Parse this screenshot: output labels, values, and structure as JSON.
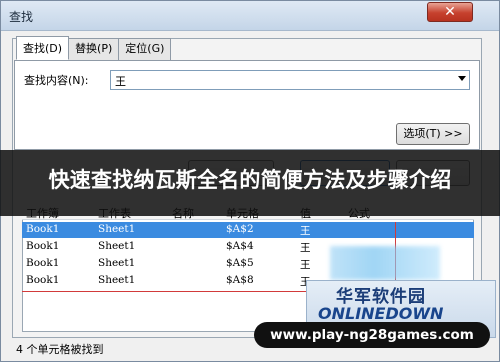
{
  "window": {
    "title": "查找",
    "close_glyph": "✕"
  },
  "tabs": [
    {
      "label": "查找(D)"
    },
    {
      "label": "替换(P)"
    },
    {
      "label": "定位(G)"
    }
  ],
  "find": {
    "label": "查找内容(N):",
    "value": "王"
  },
  "buttons": {
    "options": "选项(T) >>"
  },
  "overlay": {
    "headline": "快速查找纳瓦斯全名的简便方法及步骤介绍"
  },
  "results": {
    "columns": [
      "工作簿",
      "工作表",
      "名称",
      "单元格",
      "值",
      "公式"
    ],
    "rows": [
      {
        "book": "Book1",
        "sheet": "Sheet1",
        "cell": "$A$2",
        "value": "王"
      },
      {
        "book": "Book1",
        "sheet": "Sheet1",
        "cell": "$A$4",
        "value": "王"
      },
      {
        "book": "Book1",
        "sheet": "Sheet1",
        "cell": "$A$5",
        "value": "王"
      },
      {
        "book": "Book1",
        "sheet": "Sheet1",
        "cell": "$A$8",
        "value": "王"
      }
    ]
  },
  "status": {
    "text": "4 个单元格被找到"
  },
  "watermark": {
    "cn": "华军软件园",
    "en": "ONLINEDOWN"
  },
  "url": {
    "text": "www.play-ng28games.com"
  }
}
